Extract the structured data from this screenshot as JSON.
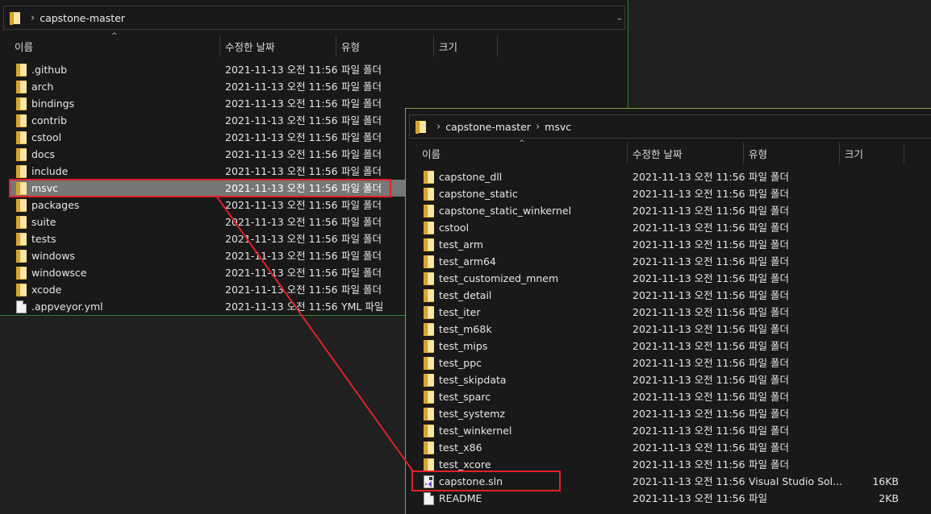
{
  "colors": {
    "highlight": "#e0202a",
    "selected_row": "#777777",
    "background": "#191919"
  },
  "window1": {
    "breadcrumb": [
      "capstone-master"
    ],
    "columns": {
      "name": "이름",
      "date": "수정한 날짜",
      "type": "유형",
      "size": "크기"
    },
    "rows": [
      {
        "name": ".github",
        "date": "2021-11-13 오전 11:56",
        "type": "파일 폴더",
        "size": "",
        "icon": "folder-icon"
      },
      {
        "name": "arch",
        "date": "2021-11-13 오전 11:56",
        "type": "파일 폴더",
        "size": "",
        "icon": "folder-icon"
      },
      {
        "name": "bindings",
        "date": "2021-11-13 오전 11:56",
        "type": "파일 폴더",
        "size": "",
        "icon": "folder-icon"
      },
      {
        "name": "contrib",
        "date": "2021-11-13 오전 11:56",
        "type": "파일 폴더",
        "size": "",
        "icon": "folder-icon"
      },
      {
        "name": "cstool",
        "date": "2021-11-13 오전 11:56",
        "type": "파일 폴더",
        "size": "",
        "icon": "folder-icon"
      },
      {
        "name": "docs",
        "date": "2021-11-13 오전 11:56",
        "type": "파일 폴더",
        "size": "",
        "icon": "folder-icon"
      },
      {
        "name": "include",
        "date": "2021-11-13 오전 11:56",
        "type": "파일 폴더",
        "size": "",
        "icon": "folder-icon"
      },
      {
        "name": "msvc",
        "date": "2021-11-13 오전 11:56",
        "type": "파일 폴더",
        "size": "",
        "icon": "folder-icon",
        "selected": true
      },
      {
        "name": "packages",
        "date": "2021-11-13 오전 11:56",
        "type": "파일 폴더",
        "size": "",
        "icon": "folder-icon"
      },
      {
        "name": "suite",
        "date": "2021-11-13 오전 11:56",
        "type": "파일 폴더",
        "size": "",
        "icon": "folder-icon"
      },
      {
        "name": "tests",
        "date": "2021-11-13 오전 11:56",
        "type": "파일 폴더",
        "size": "",
        "icon": "folder-icon"
      },
      {
        "name": "windows",
        "date": "2021-11-13 오전 11:56",
        "type": "파일 폴더",
        "size": "",
        "icon": "folder-icon"
      },
      {
        "name": "windowsce",
        "date": "2021-11-13 오전 11:56",
        "type": "파일 폴더",
        "size": "",
        "icon": "folder-icon"
      },
      {
        "name": "xcode",
        "date": "2021-11-13 오전 11:56",
        "type": "파일 폴더",
        "size": "",
        "icon": "folder-icon"
      },
      {
        "name": ".appveyor.yml",
        "date": "2021-11-13 오전 11:56",
        "type": "YML 파일",
        "size": "",
        "icon": "file-icon"
      }
    ]
  },
  "window2": {
    "breadcrumb": [
      "capstone-master",
      "msvc"
    ],
    "columns": {
      "name": "이름",
      "date": "수정한 날짜",
      "type": "유형",
      "size": "크기"
    },
    "rows": [
      {
        "name": "capstone_dll",
        "date": "2021-11-13 오전 11:56",
        "type": "파일 폴더",
        "size": "",
        "icon": "folder-icon"
      },
      {
        "name": "capstone_static",
        "date": "2021-11-13 오전 11:56",
        "type": "파일 폴더",
        "size": "",
        "icon": "folder-icon"
      },
      {
        "name": "capstone_static_winkernel",
        "date": "2021-11-13 오전 11:56",
        "type": "파일 폴더",
        "size": "",
        "icon": "folder-icon"
      },
      {
        "name": "cstool",
        "date": "2021-11-13 오전 11:56",
        "type": "파일 폴더",
        "size": "",
        "icon": "folder-icon"
      },
      {
        "name": "test_arm",
        "date": "2021-11-13 오전 11:56",
        "type": "파일 폴더",
        "size": "",
        "icon": "folder-icon"
      },
      {
        "name": "test_arm64",
        "date": "2021-11-13 오전 11:56",
        "type": "파일 폴더",
        "size": "",
        "icon": "folder-icon"
      },
      {
        "name": "test_customized_mnem",
        "date": "2021-11-13 오전 11:56",
        "type": "파일 폴더",
        "size": "",
        "icon": "folder-icon"
      },
      {
        "name": "test_detail",
        "date": "2021-11-13 오전 11:56",
        "type": "파일 폴더",
        "size": "",
        "icon": "folder-icon"
      },
      {
        "name": "test_iter",
        "date": "2021-11-13 오전 11:56",
        "type": "파일 폴더",
        "size": "",
        "icon": "folder-icon"
      },
      {
        "name": "test_m68k",
        "date": "2021-11-13 오전 11:56",
        "type": "파일 폴더",
        "size": "",
        "icon": "folder-icon"
      },
      {
        "name": "test_mips",
        "date": "2021-11-13 오전 11:56",
        "type": "파일 폴더",
        "size": "",
        "icon": "folder-icon"
      },
      {
        "name": "test_ppc",
        "date": "2021-11-13 오전 11:56",
        "type": "파일 폴더",
        "size": "",
        "icon": "folder-icon"
      },
      {
        "name": "test_skipdata",
        "date": "2021-11-13 오전 11:56",
        "type": "파일 폴더",
        "size": "",
        "icon": "folder-icon"
      },
      {
        "name": "test_sparc",
        "date": "2021-11-13 오전 11:56",
        "type": "파일 폴더",
        "size": "",
        "icon": "folder-icon"
      },
      {
        "name": "test_systemz",
        "date": "2021-11-13 오전 11:56",
        "type": "파일 폴더",
        "size": "",
        "icon": "folder-icon"
      },
      {
        "name": "test_winkernel",
        "date": "2021-11-13 오전 11:56",
        "type": "파일 폴더",
        "size": "",
        "icon": "folder-icon"
      },
      {
        "name": "test_x86",
        "date": "2021-11-13 오전 11:56",
        "type": "파일 폴더",
        "size": "",
        "icon": "folder-icon"
      },
      {
        "name": "test_xcore",
        "date": "2021-11-13 오전 11:56",
        "type": "파일 폴더",
        "size": "",
        "icon": "folder-icon"
      },
      {
        "name": "capstone.sln",
        "date": "2021-11-13 오전 11:56",
        "type": "Visual Studio Sol...",
        "size": "16KB",
        "icon": "visual-studio-solution-icon",
        "highlighted": true
      },
      {
        "name": "README",
        "date": "2021-11-13 오전 11:56",
        "type": "파일",
        "size": "2KB",
        "icon": "file-icon"
      }
    ]
  }
}
